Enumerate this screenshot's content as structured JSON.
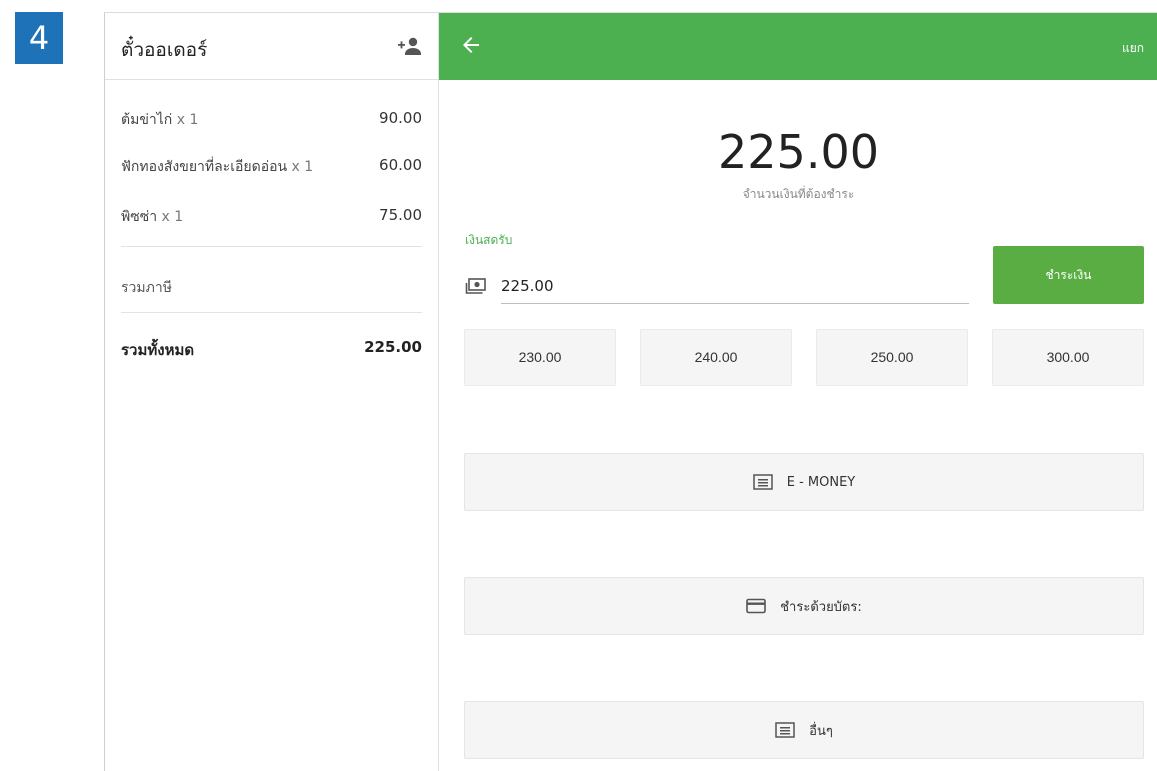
{
  "step": {
    "number": "4"
  },
  "ticket": {
    "title": "ตั๋วออเดอร์",
    "items": [
      {
        "name": "ต้มข่าไก่",
        "qty": "x 1",
        "price": "90.00"
      },
      {
        "name": "ฟักทองสังขยาที่ละเอียดอ่อน",
        "qty": "x 1",
        "price": "60.00"
      },
      {
        "name": "พิซซ่า",
        "qty": "x 1",
        "price": "75.00"
      }
    ],
    "tax_label": "รวมภาษี",
    "total_label": "รวมทั้งหมด",
    "total_value": "225.00"
  },
  "payment": {
    "split_label": "แยก",
    "amount_due": "225.00",
    "amount_caption": "จำนวนเงินที่ต้องชำระ",
    "cash_label": "เงินสดรับ",
    "cash_value": "225.00",
    "charge_label": "ชำระเงิน",
    "quick_amounts": [
      "230.00",
      "240.00",
      "250.00",
      "300.00"
    ],
    "methods": [
      {
        "label": "E - MONEY",
        "icon": "list-icon"
      },
      {
        "label": "ชำระด้วยบัตร:",
        "icon": "credit-card-icon"
      },
      {
        "label": "อื่นๆ",
        "icon": "list-icon"
      }
    ]
  },
  "colors": {
    "accent_green": "#4caf50",
    "step_badge": "#1e73b8"
  }
}
